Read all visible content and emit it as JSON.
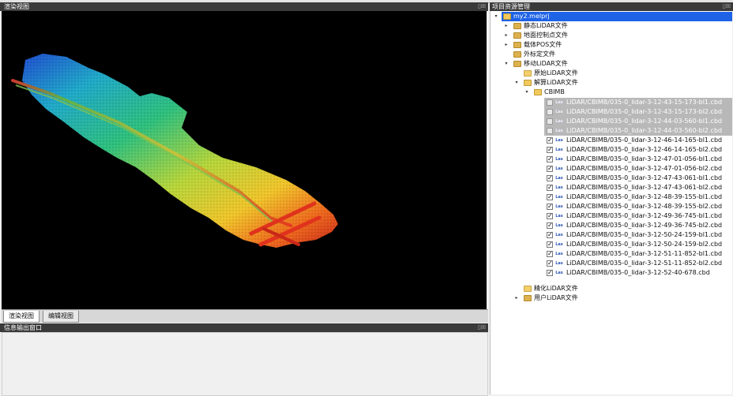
{
  "panels": {
    "render_title": "渲染视图",
    "info_title": "信息输出窗口",
    "project_title": "项目资源管理",
    "panel_controls": "▯☒"
  },
  "view_tabs": [
    "渲染视图",
    "编辑视图"
  ],
  "tree": {
    "root": "my2.melprj",
    "nodes": [
      {
        "label": "静态LiDAR文件",
        "expand": "▸",
        "depth": 1
      },
      {
        "label": "地面控制点文件",
        "expand": "▸",
        "depth": 1
      },
      {
        "label": "载体POS文件",
        "expand": "▸",
        "depth": 1
      },
      {
        "label": "外标定文件",
        "expand": "",
        "depth": 1
      },
      {
        "label": "移动LiDAR文件",
        "expand": "▾",
        "depth": 1
      },
      {
        "label": "原始LiDAR文件",
        "expand": "",
        "depth": 2
      },
      {
        "label": "解算LiDAR文件",
        "expand": "▾",
        "depth": 2
      },
      {
        "label": "CBIMB",
        "expand": "▾",
        "depth": 3
      }
    ],
    "file_icon": "Las",
    "files": [
      {
        "name": "LiDAR/CBIMB/035-0_lidar-3-12-43-15-173-bl1.cbd",
        "checked": false,
        "mark": ""
      },
      {
        "name": "LiDAR/CBIMB/035-0_lidar-3-12-43-15-173-bl2.cbd",
        "checked": false,
        "mark": ""
      },
      {
        "name": "LiDAR/CBIMB/035-0_lidar-3-12-44-03-560-bl1.cbd",
        "checked": false,
        "mark": ""
      },
      {
        "name": "LiDAR/CBIMB/035-0_lidar-3-12-44-03-560-bl2.cbd",
        "checked": false,
        "mark": ""
      },
      {
        "name": "LiDAR/CBIMB/035-0_lidar-3-12-46-14-165-bl1.cbd",
        "checked": true,
        "mark": "✓"
      },
      {
        "name": "LiDAR/CBIMB/035-0_lidar-3-12-46-14-165-bl2.cbd",
        "checked": true,
        "mark": "✓"
      },
      {
        "name": "LiDAR/CBIMB/035-0_lidar-3-12-47-01-056-bl1.cbd",
        "checked": true,
        "mark": "✓"
      },
      {
        "name": "LiDAR/CBIMB/035-0_lidar-3-12-47-01-056-bl2.cbd",
        "checked": true,
        "mark": "✓"
      },
      {
        "name": "LiDAR/CBIMB/035-0_lidar-3-12-47-43-061-bl1.cbd",
        "checked": true,
        "mark": "✓"
      },
      {
        "name": "LiDAR/CBIMB/035-0_lidar-3-12-47-43-061-bl2.cbd",
        "checked": true,
        "mark": "✓"
      },
      {
        "name": "LiDAR/CBIMB/035-0_lidar-3-12-48-39-155-bl1.cbd",
        "checked": true,
        "mark": "✓"
      },
      {
        "name": "LiDAR/CBIMB/035-0_lidar-3-12-48-39-155-bl2.cbd",
        "checked": true,
        "mark": "✓"
      },
      {
        "name": "LiDAR/CBIMB/035-0_lidar-3-12-49-36-745-bl1.cbd",
        "checked": true,
        "mark": "✓"
      },
      {
        "name": "LiDAR/CBIMB/035-0_lidar-3-12-49-36-745-bl2.cbd",
        "checked": true,
        "mark": "✓"
      },
      {
        "name": "LiDAR/CBIMB/035-0_lidar-3-12-50-24-159-bl1.cbd",
        "checked": true,
        "mark": "✓"
      },
      {
        "name": "LiDAR/CBIMB/035-0_lidar-3-12-50-24-159-bl2.cbd",
        "checked": true,
        "mark": "✓"
      },
      {
        "name": "LiDAR/CBIMB/035-0_lidar-3-12-51-11-852-bl1.cbd",
        "checked": true,
        "mark": "✓"
      },
      {
        "name": "LiDAR/CBIMB/035-0_lidar-3-12-51-11-852-bl2.cbd",
        "checked": true,
        "mark": "✓"
      },
      {
        "name": "LiDAR/CBIMB/035-0_lidar-3-12-52-40-678.cbd",
        "checked": true,
        "mark": "✓"
      }
    ],
    "after": [
      {
        "label": "精化LiDAR文件",
        "expand": "",
        "depth": 2
      },
      {
        "label": "用户LiDAR文件",
        "expand": "▸",
        "depth": 1
      }
    ]
  },
  "colors": {
    "titlebar": "#3a3a3a",
    "selection": "#1e62e6",
    "dimmed_row": "#b8b8b8"
  }
}
